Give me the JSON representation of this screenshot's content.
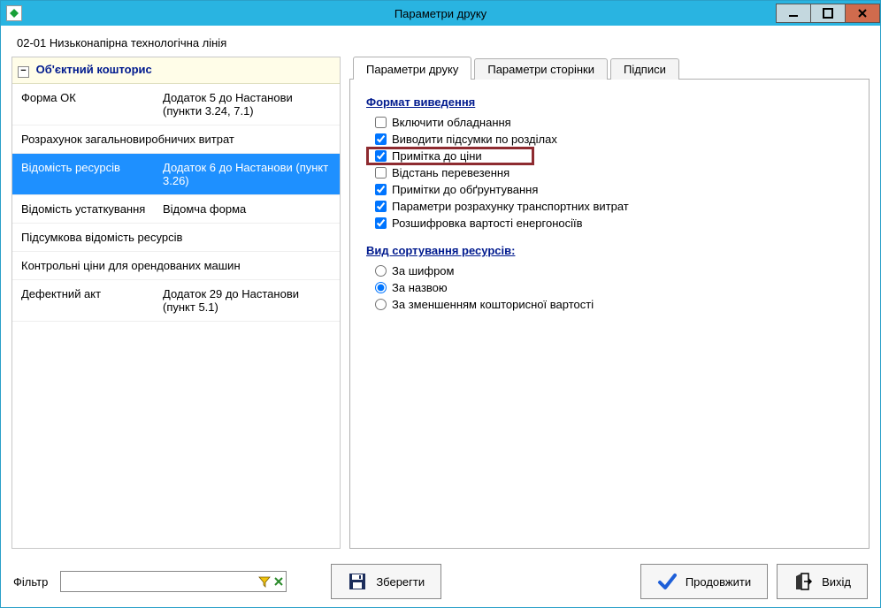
{
  "window": {
    "title": "Параметри друку"
  },
  "header": {
    "subtitle": "02-01   Низьконапірна технологічна лінія"
  },
  "sidebar": {
    "group_title": "Об'єктний кошторис",
    "rows": [
      {
        "c1": "Форма ОК",
        "c2": "Додаток 5 до Настанови (пункти 3.24, 7.1)",
        "full": false,
        "selected": false
      },
      {
        "c1": "Розрахунок загальновиробничих витрат",
        "c2": "",
        "full": true,
        "selected": false
      },
      {
        "c1": "Відомість ресурсів",
        "c2": "Додаток 6 до Настанови (пункт 3.26)",
        "full": false,
        "selected": true
      },
      {
        "c1": "Відомість устаткування",
        "c2": "Відомча форма",
        "full": false,
        "selected": false
      },
      {
        "c1": "Підсумкова відомість ресурсів",
        "c2": "",
        "full": true,
        "selected": false
      },
      {
        "c1": "Контрольні ціни для орендованих машин",
        "c2": "",
        "full": true,
        "selected": false
      },
      {
        "c1": "Дефектний акт",
        "c2": "Додаток 29 до Настанови (пункт 5.1)",
        "full": false,
        "selected": false
      }
    ]
  },
  "tabs": {
    "items": [
      {
        "label": "Параметри друку",
        "active": true
      },
      {
        "label": "Параметри сторінки",
        "active": false
      },
      {
        "label": "Підписи",
        "active": false
      }
    ]
  },
  "params": {
    "section1_title": "Формат виведення",
    "checks": [
      {
        "label": "Включити обладнання",
        "checked": false,
        "highlight": false
      },
      {
        "label": "Виводити підсумки по розділах",
        "checked": true,
        "highlight": false
      },
      {
        "label": "Примітка до ціни",
        "checked": true,
        "highlight": true
      },
      {
        "label": "Відстань перевезення",
        "checked": false,
        "highlight": false
      },
      {
        "label": "Примітки до обґрунтування",
        "checked": true,
        "highlight": false
      },
      {
        "label": "Параметри розрахунку транспортних витрат",
        "checked": true,
        "highlight": false
      },
      {
        "label": "Розшифровка вартості енергоносіїв",
        "checked": true,
        "highlight": false
      }
    ],
    "section2_title": "Вид сортування ресурсів:",
    "radios": [
      {
        "label": "За шифром",
        "checked": false
      },
      {
        "label": "За назвою",
        "checked": true
      },
      {
        "label": "За зменшенням кошторисної вартості",
        "checked": false
      }
    ]
  },
  "footer": {
    "filter_label": "Фільтр",
    "filter_value": "",
    "save": "Зберегти",
    "continue": "Продовжити",
    "exit": "Вихід"
  }
}
